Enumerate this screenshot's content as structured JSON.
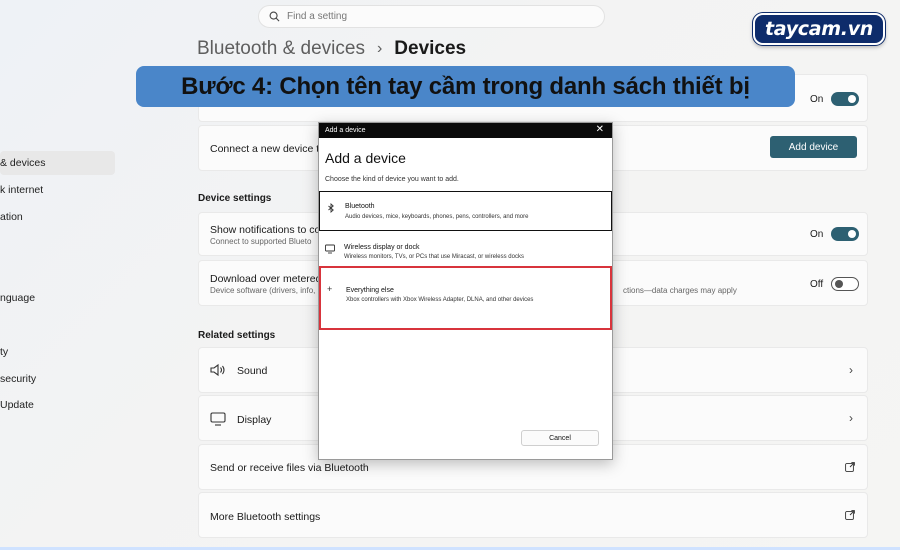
{
  "search": {
    "placeholder": "Find a setting"
  },
  "breadcrumb": {
    "parent": "Bluetooth & devices",
    "separator": "›",
    "current": "Devices"
  },
  "logo": {
    "text": "taycam.vn"
  },
  "banner": {
    "text": "Bước 4: Chọn tên tay cầm trong danh sách thiết bị"
  },
  "sidebar": {
    "items": [
      {
        "label": "& devices",
        "active": true
      },
      {
        "label": "k internet"
      },
      {
        "label": "ation"
      },
      {
        "label": "nguage"
      },
      {
        "label": "ty"
      },
      {
        "label": "security"
      },
      {
        "label": "Update"
      }
    ]
  },
  "bluetooth_row": {
    "toggle_label": "On"
  },
  "connect_row": {
    "title": "Connect a new device to \"",
    "button": "Add device"
  },
  "device_settings": {
    "label": "Device settings",
    "notifications": {
      "title": "Show notifications to conn",
      "subtitle": "Connect to supported Blueto",
      "toggle_label": "On"
    },
    "metered": {
      "title": "Download over metered co",
      "subtitle": "Device software (drivers, info,",
      "subtitle_right": "ctions—data charges may apply",
      "toggle_label": "Off"
    }
  },
  "related_settings": {
    "label": "Related settings",
    "items": [
      {
        "label": "Sound",
        "icon": "speaker-icon"
      },
      {
        "label": "Display",
        "icon": "monitor-icon"
      },
      {
        "label": "Send or receive files via Bluetooth",
        "icon": "external-link-icon"
      },
      {
        "label": "More Bluetooth settings",
        "icon": "external-link-icon"
      }
    ]
  },
  "dialog": {
    "titlebar": "Add a device",
    "close": "✕",
    "heading": "Add a device",
    "description": "Choose the kind of device you want to add.",
    "options": [
      {
        "title": "Bluetooth",
        "subtitle": "Audio devices, mice, keyboards, phones, pens, controllers, and more",
        "icon": "bluetooth-icon"
      },
      {
        "title": "Wireless display or dock",
        "subtitle": "Wireless monitors, TVs, or PCs that use Miracast, or wireless docks",
        "icon": "monitor-icon"
      },
      {
        "title": "Everything else",
        "subtitle": "Xbox controllers with Xbox Wireless Adapter, DLNA, and other devices",
        "icon": "plus-icon"
      }
    ],
    "cancel": "Cancel"
  },
  "colors": {
    "accent": "#2d6072",
    "banner": "#4a86c9",
    "highlight": "#d8343c",
    "logo_bg": "#0e2c6b"
  }
}
